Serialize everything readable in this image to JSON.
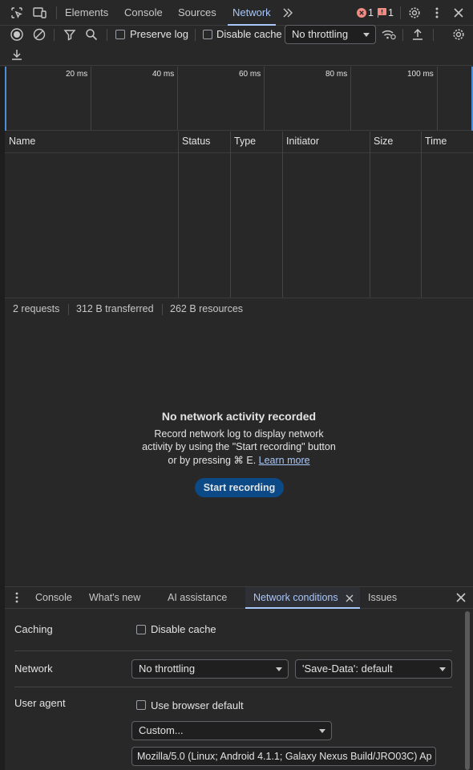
{
  "tabs": {
    "items": [
      "Elements",
      "Console",
      "Sources",
      "Network"
    ],
    "active": "Network",
    "error_count": "1",
    "issue_count": "1"
  },
  "toolbar": {
    "preserve_log": "Preserve log",
    "disable_cache": "Disable cache",
    "throttling": "No throttling"
  },
  "overview": {
    "ticks": [
      "20 ms",
      "40 ms",
      "60 ms",
      "80 ms",
      "100 ms"
    ]
  },
  "table": {
    "columns": [
      "Name",
      "Status",
      "Type",
      "Initiator",
      "Size",
      "Time"
    ]
  },
  "summary": {
    "requests": "2 requests",
    "transferred": "312 B transferred",
    "resources": "262 B resources"
  },
  "empty_state": {
    "title": "No network activity recorded",
    "line1": "Record network log to display network",
    "line2": "activity by using the \"Start recording\" button",
    "line3": "or by pressing ⌘ E.",
    "learn_more": "Learn more",
    "button": "Start recording"
  },
  "drawer": {
    "tabs": [
      "Console",
      "What's new",
      "AI assistance",
      "Network conditions",
      "Issues"
    ],
    "active": "Network conditions"
  },
  "network_conditions": {
    "caching_label": "Caching",
    "disable_cache": "Disable cache",
    "network_label": "Network",
    "throttling": "No throttling",
    "save_data": "'Save-Data': default",
    "user_agent_label": "User agent",
    "use_browser_default": "Use browser default",
    "ua_select": "Custom...",
    "ua_string": "Mozilla/5.0 (Linux; Android 4.1.1; Galaxy Nexus Build/JRO03C) Ap"
  },
  "colors": {
    "accent": "#a8c7fa",
    "error": "#f28b82",
    "button_bg": "#0b4a86",
    "background": "#282828"
  }
}
